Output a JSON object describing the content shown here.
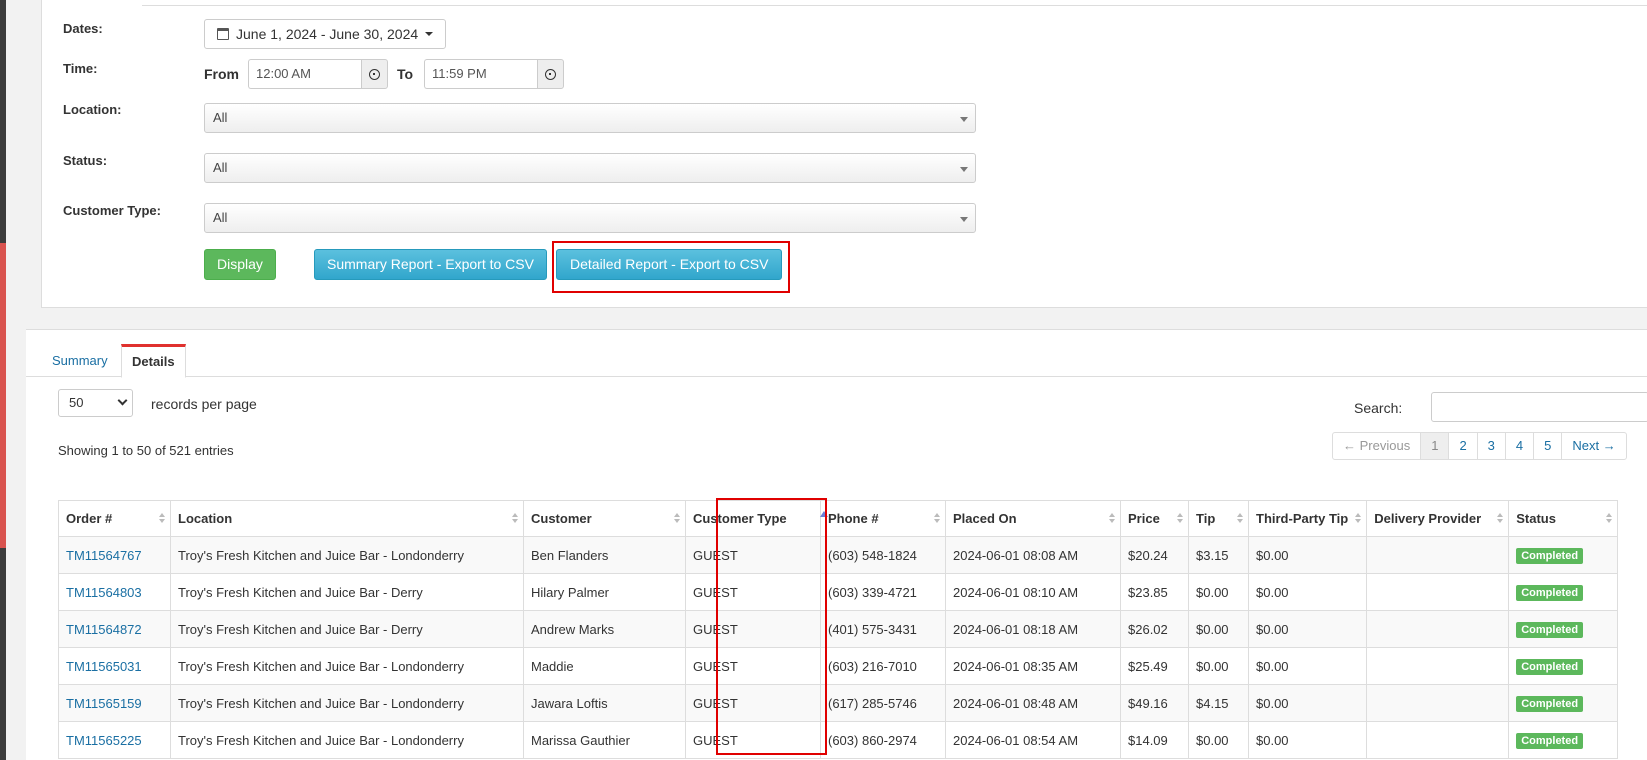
{
  "filters": {
    "dates_label": "Dates:",
    "date_range": "June 1, 2024 - June 30, 2024",
    "time_label": "Time:",
    "from_label": "From",
    "from_value": "12:00 AM",
    "to_label": "To",
    "to_value": "11:59 PM",
    "location_label": "Location:",
    "location_value": "All",
    "status_label": "Status:",
    "status_value": "All",
    "customer_type_label": "Customer Type:",
    "customer_type_value": "All"
  },
  "actions": {
    "display": "Display",
    "summary_export": "Summary Report - Export to CSV",
    "detailed_export": "Detailed Report - Export to CSV"
  },
  "tabs": {
    "summary": "Summary",
    "details": "Details"
  },
  "table_controls": {
    "per_page_value": "50",
    "per_page_label": "records per page",
    "search_label": "Search:",
    "showing": "Showing 1 to 50 of 521 entries",
    "pager": [
      "← Previous",
      "1",
      "2",
      "3",
      "4",
      "5",
      "Next →"
    ]
  },
  "columns": [
    "Order #",
    "Location",
    "Customer",
    "Customer Type",
    "Phone #",
    "Placed On",
    "Price",
    "Tip",
    "Third-Party Tip",
    "Delivery Provider",
    "Status"
  ],
  "rows": [
    [
      "TM11564767",
      "Troy's Fresh Kitchen and Juice Bar - Londonderry",
      "Ben Flanders",
      "GUEST",
      "(603) 548-1824",
      "2024-06-01 08:08 AM",
      "$20.24",
      "$3.15",
      "$0.00",
      "",
      "Completed"
    ],
    [
      "TM11564803",
      "Troy's Fresh Kitchen and Juice Bar - Derry",
      "Hilary Palmer",
      "GUEST",
      "(603) 339-4721",
      "2024-06-01 08:10 AM",
      "$23.85",
      "$0.00",
      "$0.00",
      "",
      "Completed"
    ],
    [
      "TM11564872",
      "Troy's Fresh Kitchen and Juice Bar - Derry",
      "Andrew Marks",
      "GUEST",
      "(401) 575-3431",
      "2024-06-01 08:18 AM",
      "$26.02",
      "$0.00",
      "$0.00",
      "",
      "Completed"
    ],
    [
      "TM11565031",
      "Troy's Fresh Kitchen and Juice Bar - Londonderry",
      "Maddie",
      "GUEST",
      "(603) 216-7010",
      "2024-06-01 08:35 AM",
      "$25.49",
      "$0.00",
      "$0.00",
      "",
      "Completed"
    ],
    [
      "TM11565159",
      "Troy's Fresh Kitchen and Juice Bar - Londonderry",
      "Jawara Loftis",
      "GUEST",
      "(617) 285-5746",
      "2024-06-01 08:48 AM",
      "$49.16",
      "$4.15",
      "$0.00",
      "",
      "Completed"
    ],
    [
      "TM11565225",
      "Troy's Fresh Kitchen and Juice Bar - Londonderry",
      "Marissa Gauthier",
      "GUEST",
      "(603) 860-2974",
      "2024-06-01 08:54 AM",
      "$14.09",
      "$0.00",
      "$0.00",
      "",
      "Completed"
    ]
  ],
  "colors": {
    "highlight": "#e00000",
    "link": "#1a6fa3",
    "success": "#5cb85c",
    "info": "#31b0d5"
  }
}
